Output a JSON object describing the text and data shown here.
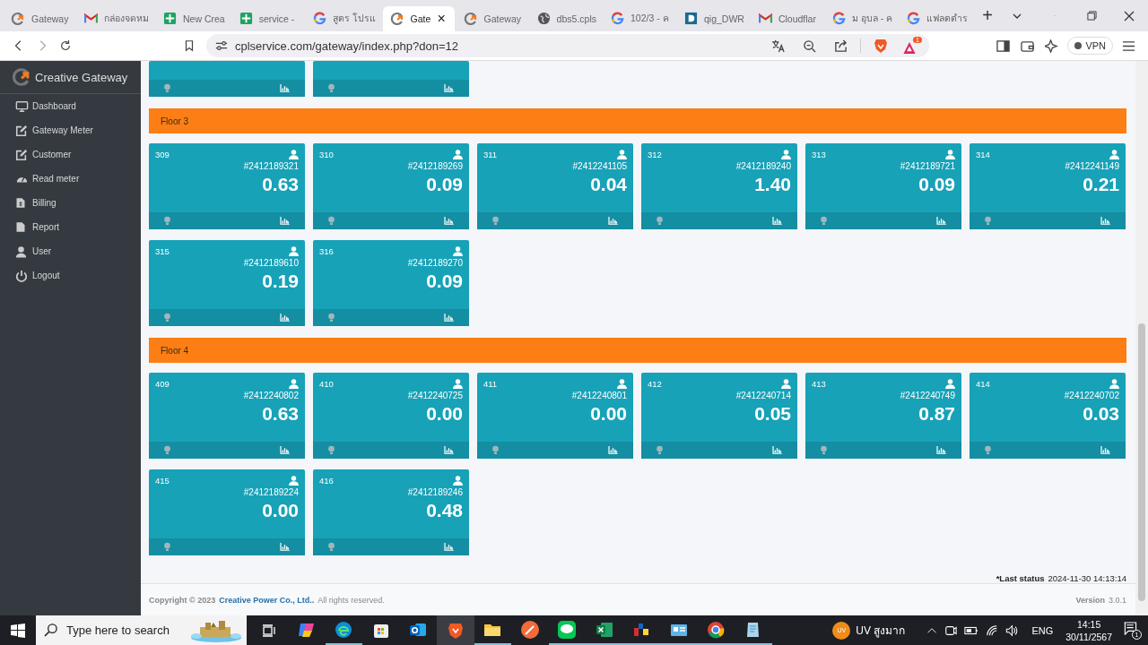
{
  "browser": {
    "tabs": [
      {
        "title": "Gateway",
        "selected": false
      },
      {
        "title": "กล่องจดหม",
        "selected": false
      },
      {
        "title": "New Crea",
        "selected": false
      },
      {
        "title": "service - ",
        "selected": false
      },
      {
        "title": "สูตร โปรแ",
        "selected": false
      },
      {
        "title": "Gate",
        "selected": true
      },
      {
        "title": "Gateway",
        "selected": false
      },
      {
        "title": "dbs5.cpls",
        "selected": false
      },
      {
        "title": "102/3 - ค",
        "selected": false
      },
      {
        "title": "qig_DWR",
        "selected": false
      },
      {
        "title": "Cloudflar",
        "selected": false
      },
      {
        "title": "ม อุบล - ค",
        "selected": false
      },
      {
        "title": "แฟลตตำร",
        "selected": false
      }
    ],
    "close_label": "×",
    "new_tab": "+",
    "address": "cplservice.com/gateway/index.php?don=12",
    "rewards_badge": "1",
    "vpn_label": "VPN"
  },
  "sidebar": {
    "brand": "Creative Gateway",
    "items": [
      {
        "label": "Dashboard"
      },
      {
        "label": "Gateway Meter"
      },
      {
        "label": "Customer"
      },
      {
        "label": "Read meter"
      },
      {
        "label": "Billing"
      },
      {
        "label": "Report"
      },
      {
        "label": "User"
      },
      {
        "label": "Logout"
      }
    ]
  },
  "sections": [
    {
      "meters": [
        {
          "kind": "cut"
        },
        {
          "kind": "cut"
        }
      ]
    },
    {
      "title": "Floor 3",
      "meters": [
        {
          "kind": "meter",
          "room": "309",
          "meter_id": "#2412189321",
          "value": "0.63"
        },
        {
          "kind": "meter",
          "room": "310",
          "meter_id": "#2412189269",
          "value": "0.09"
        },
        {
          "kind": "meter",
          "room": "311",
          "meter_id": "#2412241105",
          "value": "0.04"
        },
        {
          "kind": "meter",
          "room": "312",
          "meter_id": "#2412189240",
          "value": "1.40"
        },
        {
          "kind": "meter",
          "room": "313",
          "meter_id": "#2412189721",
          "value": "0.09"
        },
        {
          "kind": "meter",
          "room": "314",
          "meter_id": "#2412241149",
          "value": "0.21"
        },
        {
          "kind": "meter",
          "room": "315",
          "meter_id": "#2412189610",
          "value": "0.19"
        },
        {
          "kind": "meter",
          "room": "316",
          "meter_id": "#2412189270",
          "value": "0.09"
        }
      ]
    },
    {
      "title": "Floor 4",
      "meters": [
        {
          "kind": "meter",
          "room": "409",
          "meter_id": "#2412240802",
          "value": "0.63"
        },
        {
          "kind": "meter",
          "room": "410",
          "meter_id": "#2412240725",
          "value": "0.00"
        },
        {
          "kind": "meter",
          "room": "411",
          "meter_id": "#2412240801",
          "value": "0.00"
        },
        {
          "kind": "meter",
          "room": "412",
          "meter_id": "#2412240714",
          "value": "0.05"
        },
        {
          "kind": "meter",
          "room": "413",
          "meter_id": "#2412240749",
          "value": "0.87"
        },
        {
          "kind": "meter",
          "room": "414",
          "meter_id": "#2412240702",
          "value": "0.03"
        },
        {
          "kind": "meter",
          "room": "415",
          "meter_id": "#2412189224",
          "value": "0.00"
        },
        {
          "kind": "meter",
          "room": "416",
          "meter_id": "#2412189246",
          "value": "0.48"
        }
      ]
    }
  ],
  "last_status": {
    "label": "*Last status",
    "value": "2024-11-30 14:13:14"
  },
  "footer": {
    "copyright": "Copyright © 2023",
    "company": "Creative Power Co., Ltd..",
    "rights": "All rights reserved.",
    "version_label": "Version",
    "version": "3.0.1"
  },
  "taskbar": {
    "search_placeholder": "Type here to search",
    "apps": [
      {
        "running": false,
        "selected": false
      },
      {
        "running": true,
        "selected": false
      },
      {
        "running": false,
        "selected": false
      },
      {
        "running": false,
        "selected": false
      },
      {
        "running": false,
        "selected": true
      },
      {
        "running": true,
        "selected": false
      },
      {
        "running": false,
        "selected": false
      },
      {
        "running": true,
        "selected": false
      },
      {
        "running": true,
        "selected": false
      },
      {
        "running": true,
        "selected": false
      },
      {
        "running": true,
        "selected": false
      },
      {
        "running": true,
        "selected": false
      },
      {
        "running": true,
        "selected": false
      }
    ],
    "weather_badge": "UV",
    "weather_text": "UV สูงมาก",
    "language": "ENG",
    "time": "14:15",
    "date": "30/11/2567",
    "notifications": "1"
  }
}
